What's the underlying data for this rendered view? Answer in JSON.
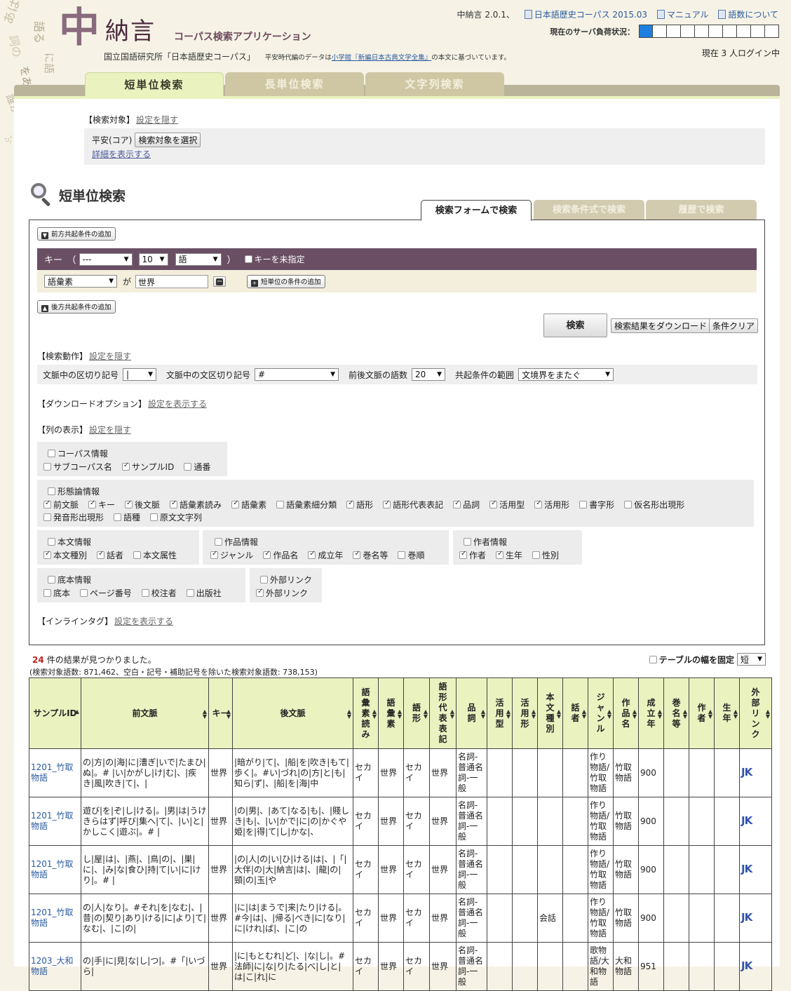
{
  "header": {
    "logo_mark": "中",
    "logo_name": "納言",
    "logo_sub": "コーパス検索アプリケーション",
    "institute": "国立国語研究所「日本語歴史コーパス」",
    "note_pre": "平安時代編のデータは",
    "note_link1": "小学館",
    "note_link2": "『新編日本古典文学全集』",
    "note_post": "の本文に基づいています。",
    "version": "中納言 2.0.1、",
    "link_corpus": "日本語歴史コーパス 2015.03",
    "link_manual": "マニュアル",
    "link_words": "語数について",
    "load_label": "現在のサーバ負荷状況：",
    "login_status": "現在 3 人ログイン中"
  },
  "main_tabs": [
    "短単位検索",
    "長単位検索",
    "文字列検索"
  ],
  "target": {
    "label": "【検索対象】",
    "toggle": "設定を隠す",
    "value": "平安(コア)",
    "select_button": "検索対象を選択",
    "detail_link": "詳細を表示する"
  },
  "search_title": "短単位検索",
  "sub_tabs": [
    "検索フォームで検索",
    "検索条件式で検索",
    "履歴で検索"
  ],
  "form": {
    "add_before": "前方共起条件の追加",
    "key_label": "キー　（",
    "key_sel1": "---",
    "key_sel2": "10",
    "key_sel3": "語",
    "key_close": "）",
    "key_unspecified": "キーを未指定",
    "cond_field": "語彙素",
    "cond_ga": "が",
    "cond_value": "世界",
    "add_short_unit": "短単位の条件の追加",
    "add_after": "後方共起条件の追加",
    "search_btn": "検索",
    "download_btn": "検索結果をダウンロード",
    "clear_btn": "条件クリア"
  },
  "actions": {
    "label": "【検索動作】",
    "toggle": "設定を隠す",
    "ctx_delim_label": "文脈中の区切り記号",
    "ctx_delim": "|",
    "sent_delim_label": "文脈中の文区切り記号",
    "sent_delim": "#",
    "ctx_words_label": "前後文脈の語数",
    "ctx_words": "20",
    "range_label": "共起条件の範囲",
    "range": "文境界をまたぐ"
  },
  "download_opts": {
    "label": "【ダウンロードオプション】",
    "toggle": "設定を表示する"
  },
  "columns": {
    "label": "【列の表示】",
    "toggle": "設定を隠す",
    "corpus": {
      "title": "コーパス情報",
      "items": [
        [
          "サブコーパス名",
          false
        ],
        [
          "サンプルID",
          true
        ],
        [
          "通番",
          false
        ]
      ]
    },
    "morph": {
      "title": "形態論情報",
      "row1": [
        [
          "前文脈",
          true
        ],
        [
          "キー",
          true
        ],
        [
          "後文脈",
          true
        ],
        [
          "語彙素読み",
          true
        ],
        [
          "語彙素",
          true
        ],
        [
          "語彙素細分類",
          false
        ],
        [
          "語形",
          true
        ],
        [
          "語形代表表記",
          true
        ],
        [
          "品詞",
          true
        ],
        [
          "活用型",
          true
        ],
        [
          "活用形",
          true
        ],
        [
          "書字形",
          false
        ],
        [
          "仮名形出現形",
          false
        ]
      ],
      "row2": [
        [
          "発音形出現形",
          false
        ],
        [
          "語種",
          false
        ],
        [
          "原文文字列",
          false
        ]
      ]
    },
    "text": {
      "title": "本文情報",
      "items": [
        [
          "本文種別",
          true
        ],
        [
          "話者",
          true
        ],
        [
          "本文属性",
          false
        ]
      ]
    },
    "work": {
      "title": "作品情報",
      "items": [
        [
          "ジャンル",
          true
        ],
        [
          "作品名",
          true
        ],
        [
          "成立年",
          true
        ],
        [
          "巻名等",
          true
        ],
        [
          "巻順",
          false
        ]
      ]
    },
    "author": {
      "title": "作者情報",
      "items": [
        [
          "作者",
          true
        ],
        [
          "生年",
          true
        ],
        [
          "性別",
          false
        ]
      ]
    },
    "source": {
      "title": "底本情報",
      "items": [
        [
          "底本",
          false
        ],
        [
          "ページ番号",
          false
        ],
        [
          "校注者",
          false
        ],
        [
          "出版社",
          false
        ]
      ]
    },
    "external": {
      "title": "外部リンク",
      "items": [
        [
          "外部リンク",
          true
        ]
      ]
    }
  },
  "inline_tag": {
    "label": "【インラインタグ】",
    "toggle": "設定を表示する"
  },
  "results": {
    "count": "24",
    "count_suffix": "件の結果が見つかりました。",
    "stats": "(検索対象語数: 871,462、空白・記号・補助記号を除いた検索対象語数: 738,153)",
    "fix_width": "テーブルの幅を固定",
    "width_opt": "短",
    "headers": [
      "サンプルID",
      "前文脈",
      "キー",
      "後文脈",
      "語彙素読み",
      "語彙素",
      "語形",
      "語形代表表記",
      "品詞",
      "活用型",
      "活用形",
      "本文種別",
      "話者",
      "ジャンル",
      "作品名",
      "成立年",
      "巻名等",
      "作者",
      "生年",
      "外部リンク"
    ],
    "rows": [
      [
        "1201_竹取物語",
        "の|方|の|海|に|漕ぎ|いで|たまひ|ぬ|。# |い|かがし|け|む|、|疾き|風|吹き|て|、|",
        "世界",
        "|暗がり|て|、|船|を|吹き|もて|歩く|。#い|づれ|の|方|と|も|知ら|ず|、|船|を|海|中",
        "セカイ",
        "世界",
        "セカイ",
        "世界",
        "名詞-普通名詞-一般",
        "",
        "",
        "",
        "",
        "作り物語/竹取物語",
        "竹取物語",
        "900",
        "",
        "",
        "",
        "JK"
      ],
      [
        "1201_竹取物語",
        "遊び|を|ぞ|し|ける|。|男|は|うけきらはず|呼び|集へ|て|、|い|と|かしこく|遊ぶ|。# |",
        "世界",
        "|の|男|、|あて|なる|も|、|賤しき|も|、|い|かで|に|の|かぐや姫|を|得|て|し|かな|、",
        "セカイ",
        "世界",
        "セカイ",
        "世界",
        "名詞-普通名詞-一般",
        "",
        "",
        "",
        "",
        "作り物語/竹取物語",
        "竹取物語",
        "900",
        "",
        "",
        "",
        "JK"
      ],
      [
        "1201_竹取物語",
        "し|屋|は|、|燕|、|鳥|の|、|巣|に|、|み|な|食ひ|持|て|い|に|けり|。# |",
        "世界",
        "|の|人|の|い|ひ|ける|は|、|「|大伴|の|大|納言|は|、|龍|の|頸|の|玉|や",
        "セカイ",
        "世界",
        "セカイ",
        "世界",
        "名詞-普通名詞-一般",
        "",
        "",
        "",
        "",
        "作り物語/竹取物語",
        "竹取物語",
        "900",
        "",
        "",
        "",
        "JK"
      ],
      [
        "1201_竹取物語",
        "の|人|なり|。#それ|を|なむ|、|昔|の|契り|あり|ける|に|より|て|なむ|、|こ|の|",
        "世界",
        "|に|は|まうで|来|たり|ける|。#今|は|、|帰る|べき|に|なり|に|けれ|ば|、|こ|の",
        "セカイ",
        "世界",
        "セカイ",
        "世界",
        "名詞-普通名詞-一般",
        "",
        "",
        "会話",
        "",
        "作り物語/竹取物語",
        "竹取物語",
        "900",
        "",
        "",
        "",
        "JK"
      ],
      [
        "1203_大和物語",
        "の|手|に|見|な|し|つ|。#「|いづら|",
        "世界",
        "|に|もとむれ|ど|、|な|し|。#法師|に|な|り|たる|べ|し|と|は|こ|れ|に",
        "セカイ",
        "世界",
        "セカイ",
        "世界",
        "名詞-普通名詞-一般",
        "",
        "",
        "",
        "",
        "歌物語/大和物語",
        "大和物語",
        "951",
        "",
        "",
        "",
        "JK"
      ]
    ]
  }
}
